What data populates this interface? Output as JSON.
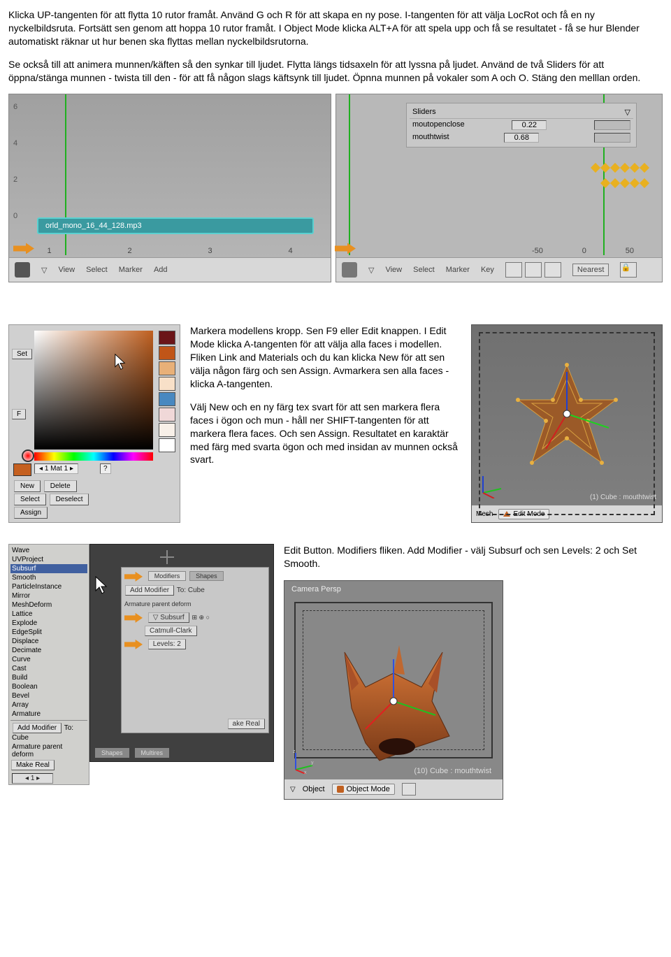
{
  "paragraphs": {
    "p1": "Klicka UP-tangenten för att flytta 10 rutor framåt. Använd G och R för att skapa en ny pose. I-tangenten för att välja LocRot och få en ny nyckelbildsruta. Fortsätt sen genom att hoppa 10 rutor framåt. I Object Mode klicka ALT+A för att spela upp och få se resultatet - få se hur Blender automatiskt räknar ut hur benen ska flyttas mellan nyckelbildsrutorna.",
    "p2": "Se också till att animera munnen/käften så den synkar till ljudet. Flytta längs tidsaxeln för att lyssna på ljudet. Använd de två Sliders för att öppna/stänga munnen - twista till den - för att få någon slags käftsynk till ljudet. Öpnna munnen på vokaler som A och O. Stäng den melllan orden.",
    "p3": "Markera modellens kropp. Sen F9 eller Edit knappen. I Edit Mode klicka A-tangenten för att välja alla faces i modellen. Fliken Link and Materials och du kan klicka New för att sen välja någon färg och sen Assign. Avmarkera sen alla faces - klicka A-tangenten.",
    "p4": "Välj New och en ny färg tex svart för att sen markera flera faces i ögon och mun - håll ner SHIFT-tangenten för att markera flera faces. Och sen Assign. Resultatet en karaktär med färg med svarta ögon och med insidan av munnen också svart.",
    "p5": "Edit Button. Modifiers fliken. Add Modifier - välj Subsurf och sen Levels: 2 och Set Smooth."
  },
  "timeline_left": {
    "y_ticks": [
      "6",
      "4",
      "2",
      "0"
    ],
    "audio_strip": "orld_mono_16_44_128.mp3",
    "x_ticks": [
      "1",
      "2",
      "3",
      "4"
    ],
    "menu": [
      "View",
      "Select",
      "Marker",
      "Add"
    ]
  },
  "timeline_right": {
    "sliders_title": "Sliders",
    "slider1_name": "moutopenclose",
    "slider1_val": "0.22",
    "slider2_name": "mouthtwist",
    "slider2_val": "0.68",
    "x_ticks": [
      "-50",
      "0",
      "50"
    ],
    "menu": [
      "View",
      "Select",
      "Marker",
      "Key"
    ],
    "mode": "Nearest"
  },
  "colorpicker": {
    "set": "Set",
    "f": "F",
    "mat": "1 Mat 1",
    "q": "?",
    "new": "New",
    "delete": "Delete",
    "select": "Select",
    "deselect": "Deselect",
    "assign": "Assign"
  },
  "viewport1": {
    "obj_label": "(1) Cube : mouthtwist",
    "menu_mesh": "Mesh",
    "mode": "Edit Mode"
  },
  "modifiers": {
    "list": [
      "Wave",
      "UVProject",
      "Subsurf",
      "Smooth",
      "ParticleInstance",
      "Mirror",
      "MeshDeform",
      "Lattice",
      "Explode",
      "EdgeSplit",
      "Displace",
      "Decimate",
      "Curve",
      "Cast",
      "Build",
      "Boolean",
      "Bevel",
      "Array",
      "Armature"
    ],
    "selected": "Subsurf",
    "add_modifier_btn": "Add Modifier",
    "to_cube": "To: Cube",
    "tabs": [
      "Modifiers",
      "Shapes"
    ],
    "armature_deform": "Armature parent deform",
    "subsurf_label": "Subsurf",
    "catmull": "Catmull-Clark",
    "levels": "Levels: 2",
    "make_real": "ake Real",
    "footer_tabs": [
      "Shapes",
      "Multires"
    ],
    "footer_add": "Add Modifier",
    "footer_to": "To: Cube",
    "footer_deform": "Armature parent deform",
    "footer_make_real": "Make Real",
    "num": "1"
  },
  "camera": {
    "title": "Camera Persp",
    "obj_label": "(10) Cube : mouthtwist",
    "menu_object": "Object",
    "mode": "Object Mode"
  }
}
